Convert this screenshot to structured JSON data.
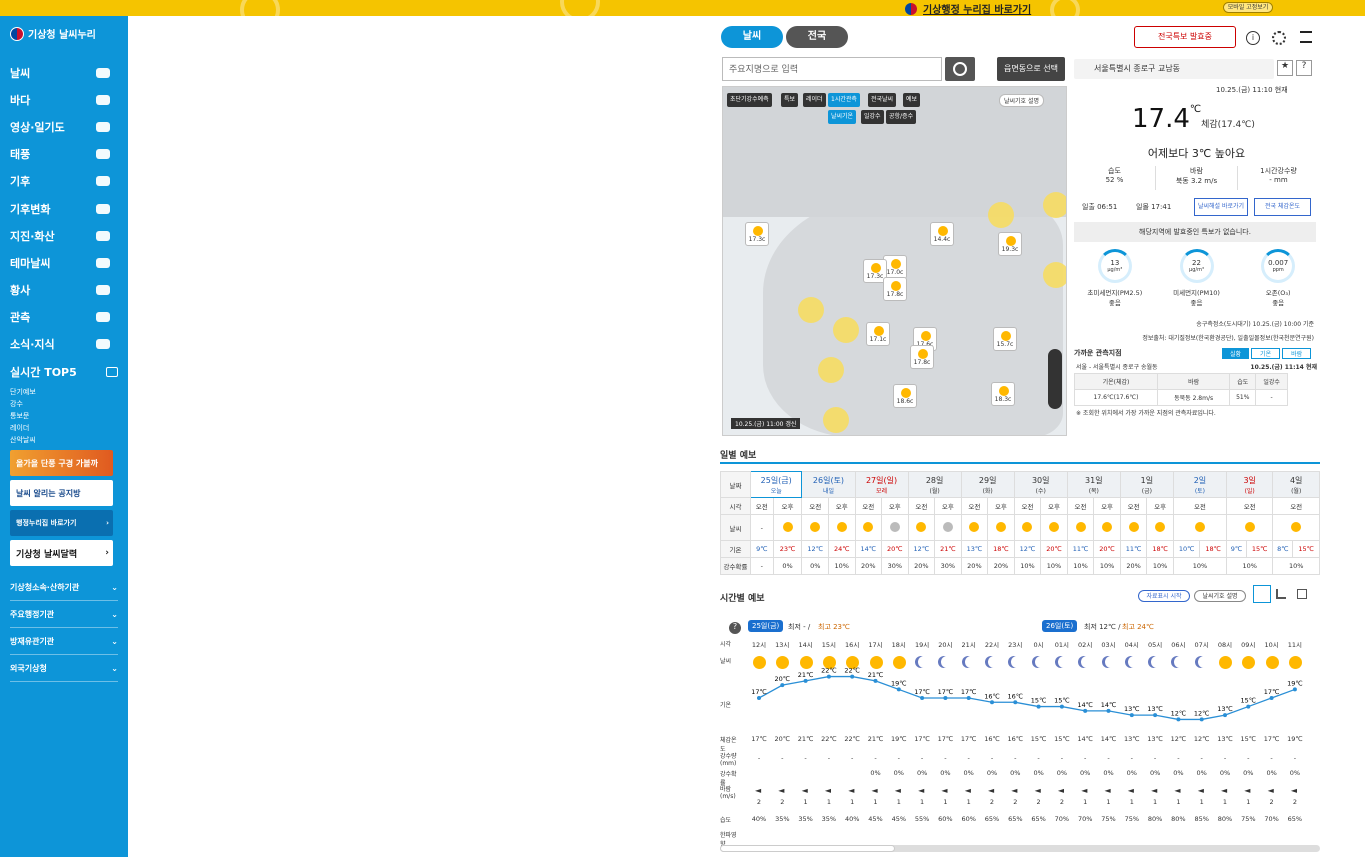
{
  "top": {
    "gov_link": "기상행정 누리집 바로가기",
    "low_btn": "모바일 고정보기"
  },
  "sidebar": {
    "logo": "기상청 날씨누리",
    "items": [
      {
        "label": "날씨"
      },
      {
        "label": "바다"
      },
      {
        "label": "영상·일기도"
      },
      {
        "label": "태풍"
      },
      {
        "label": "기후"
      },
      {
        "label": "기후변화"
      },
      {
        "label": "지진·화산"
      },
      {
        "label": "테마날씨"
      },
      {
        "label": "황사"
      },
      {
        "label": "관측"
      },
      {
        "label": "소식·지식"
      }
    ],
    "top5_title": "실시간 TOP5",
    "top5": [
      "단기예보",
      "강수",
      "통보문",
      "레이더",
      "산악날씨"
    ],
    "banners": [
      "올가을 단풍 구경 가볼까",
      "날씨 알리는 공지방",
      "행정누리집 바로가기",
      "기상청 날씨달력"
    ],
    "links": [
      "기상청소속·산하기관",
      "주요행정기관",
      "방재유관기관",
      "외국기상청"
    ]
  },
  "main": {
    "tabs": [
      "날씨",
      "전국"
    ],
    "search_placeholder": "주요지명으로 입력",
    "select_btn": "읍면동으로 선택",
    "map_controls": [
      "초단기강수예측",
      "특보",
      "레이더",
      "1시간관측",
      "전국날씨",
      "예보"
    ],
    "map_sub": [
      "날씨기온",
      "일강수",
      "공항/증수"
    ],
    "map_legend": "날씨기호 설명",
    "map_time": "10.25.(금) 11:00 갱신",
    "map_pins": [
      "17.3c",
      "14.4c",
      "17.0c",
      "17.3c",
      "17.8c",
      "19.3c",
      "17.1c",
      "17.6c",
      "17.8c",
      "15.7c",
      "18.3c",
      "18.6c"
    ]
  },
  "panel": {
    "warn_btn": "전국특보 발효중",
    "location": "서울특별시 종로구 교남동",
    "updated": "10.25.(금) 11:10 현재",
    "temp": "17.4",
    "unit": "℃",
    "feels": "체감(17.4℃)",
    "compare": "어제보다 3℃ 높아요",
    "humidity_label": "습도",
    "humidity": "52 %",
    "wind_label": "바람",
    "wind": "북동 3.2 m/s",
    "rain_label": "1시간강수량",
    "rain": "- mm",
    "sunrise": "일출 06:51",
    "sunset": "일몰 17:41",
    "btn1": "날씨해설 바로가기",
    "btn2": "전국 체감온도",
    "no_warn": "해당지역에 발효중인 특보가 없습니다.",
    "air": [
      {
        "val": "13",
        "unit": "μg/m³",
        "name": "초미세먼지(PM2.5)",
        "grade": "좋음"
      },
      {
        "val": "22",
        "unit": "μg/m³",
        "name": "미세먼지(PM10)",
        "grade": "좋음"
      },
      {
        "val": "0.007",
        "unit": "ppm",
        "name": "오존(O₃)",
        "grade": "좋음"
      }
    ],
    "air_src": "송구측정소(도시대기) 10.25.(금) 10:00 기준",
    "air_src2": "정보출처: 대기질정보(한국환경공단), 일출일몰정보(한국천문연구원)",
    "near_title": "가까운 관측지점",
    "near_tabs": [
      "실황",
      "기온",
      "바람"
    ],
    "near_loc": "서울 - 서울특별시 종로구 송월동",
    "near_time": "10.25.(금) 11:14 현재",
    "near_head": [
      "기온(체감)",
      "바람",
      "습도",
      "일강수"
    ],
    "near_row": [
      "17.6℃(17.6℃)",
      "동북동 2.8m/s",
      "51%",
      "-"
    ],
    "near_note": "※ 조회한 위치에서 가장 가까운 지점의 관측자료입니다."
  },
  "daily": {
    "title": "일별 예보",
    "days": [
      {
        "d": "25일(금)",
        "s": "오늘",
        "c": "#1f5fb5",
        "am": "-",
        "pm": "sun",
        "lo": "9℃",
        "hi": "23℃",
        "p1": "-",
        "p2": "0%"
      },
      {
        "d": "26일(토)",
        "s": "내일",
        "c": "#1f5fb5",
        "am": "sun",
        "pm": "sun",
        "lo": "12℃",
        "hi": "24℃",
        "p1": "0%",
        "p2": "10%"
      },
      {
        "d": "27일(일)",
        "s": "모레",
        "c": "#c00",
        "am": "sun",
        "pm": "cloud",
        "lo": "14℃",
        "hi": "20℃",
        "p1": "20%",
        "p2": "30%"
      },
      {
        "d": "28일",
        "s": "(월)",
        "c": "#333",
        "am": "sun",
        "pm": "cloud",
        "lo": "12℃",
        "hi": "21℃",
        "p1": "20%",
        "p2": "30%"
      },
      {
        "d": "29일",
        "s": "(화)",
        "c": "#333",
        "am": "sun",
        "pm": "sun",
        "lo": "13℃",
        "hi": "18℃",
        "p1": "20%",
        "p2": "20%"
      },
      {
        "d": "30일",
        "s": "(수)",
        "c": "#333",
        "am": "sun",
        "pm": "sun",
        "lo": "12℃",
        "hi": "20℃",
        "p1": "10%",
        "p2": "10%"
      },
      {
        "d": "31일",
        "s": "(목)",
        "c": "#333",
        "am": "sun",
        "pm": "sun",
        "lo": "11℃",
        "hi": "20℃",
        "p1": "10%",
        "p2": "10%"
      },
      {
        "d": "1일",
        "s": "(금)",
        "c": "#333",
        "am": "sun",
        "pm": "sun",
        "lo": "11℃",
        "hi": "18℃",
        "p1": "20%",
        "p2": "10%"
      },
      {
        "d": "2일",
        "s": "(토)",
        "c": "#1f5fb5",
        "am": "종일",
        "pm": "sun",
        "lo": "10℃",
        "hi": "18℃",
        "p1": "10%",
        "p2": ""
      },
      {
        "d": "3일",
        "s": "(일)",
        "c": "#c00",
        "am": "종일",
        "pm": "sun",
        "lo": "9℃",
        "hi": "15℃",
        "p1": "10%",
        "p2": ""
      },
      {
        "d": "4일",
        "s": "(월)",
        "c": "#333",
        "am": "종일",
        "pm": "sun",
        "lo": "8℃",
        "hi": "15℃",
        "p1": "10%",
        "p2": ""
      }
    ],
    "row_labels": [
      "날짜",
      "시각",
      "날씨",
      "기온",
      "강수확률"
    ],
    "am": "오전",
    "pm": "오후"
  },
  "hourly": {
    "title": "시간별 예보",
    "btn": "자료표시 시작",
    "legend": "날씨기호 설명",
    "day1": "25일(금)",
    "day1_lo": "최저 - /",
    "day1_hi": "최고 23℃",
    "day2": "26일(토)",
    "day2_lo": "최저 12℃ /",
    "day2_hi": "최고 24℃",
    "hours": [
      "12시",
      "13시",
      "14시",
      "15시",
      "16시",
      "17시",
      "18시",
      "19시",
      "20시",
      "21시",
      "22시",
      "23시",
      "0시",
      "01시",
      "02시",
      "03시",
      "04시",
      "05시",
      "06시",
      "07시",
      "08시",
      "09시",
      "10시",
      "11시"
    ],
    "temps": [
      17,
      20,
      21,
      22,
      22,
      21,
      19,
      17,
      17,
      17,
      16,
      16,
      15,
      15,
      14,
      14,
      13,
      13,
      12,
      12,
      13,
      15,
      17,
      19
    ],
    "icons": [
      "sun",
      "sun",
      "pcloud",
      "pcloud",
      "pcloud",
      "sun",
      "sun",
      "moon",
      "moon",
      "moon",
      "moon",
      "moon",
      "moon",
      "moon",
      "moon",
      "moon",
      "moon",
      "moon",
      "moon",
      "moon",
      "sun",
      "sun",
      "sun",
      "sun"
    ],
    "feels": [
      "17℃",
      "20℃",
      "21℃",
      "22℃",
      "22℃",
      "21℃",
      "19℃",
      "17℃",
      "17℃",
      "17℃",
      "16℃",
      "16℃",
      "15℃",
      "15℃",
      "14℃",
      "14℃",
      "13℃",
      "13℃",
      "12℃",
      "12℃",
      "13℃",
      "15℃",
      "17℃",
      "19℃"
    ],
    "rain": [
      "-",
      "-",
      "-",
      "-",
      "-",
      "-",
      "-",
      "-",
      "-",
      "-",
      "-",
      "-",
      "-",
      "-",
      "-",
      "-",
      "-",
      "-",
      "-",
      "-",
      "-",
      "-",
      "-",
      "-"
    ],
    "prob": [
      "",
      "",
      "",
      "",
      "",
      "0%",
      "0%",
      "0%",
      "0%",
      "0%",
      "0%",
      "0%",
      "0%",
      "0%",
      "0%",
      "0%",
      "0%",
      "0%",
      "0%",
      "0%",
      "0%",
      "0%",
      "0%",
      "0%"
    ],
    "wind": [
      "2",
      "2",
      "1",
      "1",
      "1",
      "1",
      "1",
      "1",
      "1",
      "1",
      "2",
      "2",
      "2",
      "2",
      "1",
      "1",
      "1",
      "1",
      "1",
      "1",
      "1",
      "1",
      "2",
      "2"
    ],
    "hum": [
      "40%",
      "35%",
      "35%",
      "35%",
      "40%",
      "45%",
      "45%",
      "55%",
      "60%",
      "60%",
      "65%",
      "65%",
      "65%",
      "70%",
      "70%",
      "75%",
      "75%",
      "80%",
      "80%",
      "85%",
      "80%",
      "75%",
      "70%",
      "65%"
    ],
    "row_labels": [
      "시각",
      "날씨",
      "기온",
      "체감온도",
      "강수량(mm)",
      "강수확률",
      "바람(m/s)",
      "습도",
      "한파영향"
    ]
  },
  "colors": {
    "brand": "#0d95d8",
    "accent": "#f5c400"
  }
}
